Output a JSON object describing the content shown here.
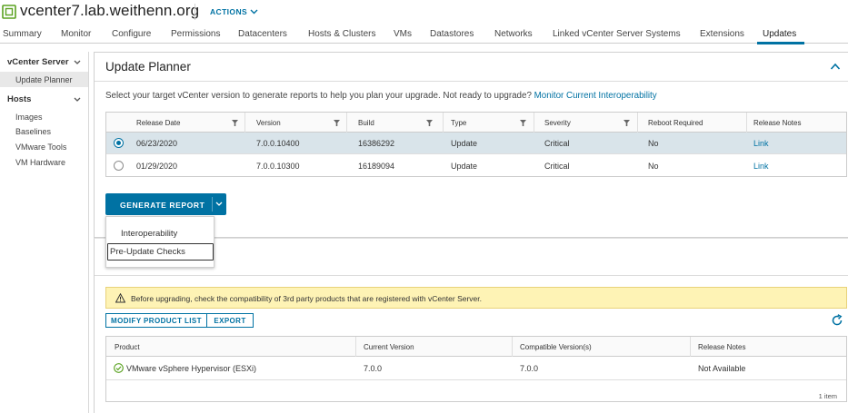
{
  "header": {
    "host": "vcenter7.lab.weithenn.org",
    "actions_label": "ACTIONS"
  },
  "tabs": [
    {
      "label": "Summary"
    },
    {
      "label": "Monitor"
    },
    {
      "label": "Configure"
    },
    {
      "label": "Permissions"
    },
    {
      "label": "Datacenters"
    },
    {
      "label": "Hosts & Clusters"
    },
    {
      "label": "VMs"
    },
    {
      "label": "Datastores"
    },
    {
      "label": "Networks"
    },
    {
      "label": "Linked vCenter Server Systems"
    },
    {
      "label": "Extensions"
    },
    {
      "label": "Updates",
      "active": true
    }
  ],
  "sidebar": {
    "groups": [
      {
        "label": "vCenter Server",
        "items": [
          {
            "label": "Update Planner",
            "active": true
          }
        ]
      },
      {
        "label": "Hosts",
        "items": [
          {
            "label": "Images"
          },
          {
            "label": "Baselines"
          },
          {
            "label": "VMware Tools"
          },
          {
            "label": "VM Hardware"
          }
        ]
      }
    ]
  },
  "planner": {
    "title": "Update Planner",
    "intro_text": "Select your target vCenter version to generate reports to help you plan your upgrade. Not ready to upgrade?",
    "intro_link": "Monitor Current Interoperability",
    "columns": [
      "Release Date",
      "Version",
      "Build",
      "Type",
      "Severity",
      "Reboot Required",
      "Release Notes"
    ],
    "rows": [
      {
        "release_date": "06/23/2020",
        "version": "7.0.0.10400",
        "build": "16386292",
        "type": "Update",
        "severity": "Critical",
        "reboot": "No",
        "notes": "Link",
        "selected": true
      },
      {
        "release_date": "01/29/2020",
        "version": "7.0.0.10300",
        "build": "16189094",
        "type": "Update",
        "severity": "Critical",
        "reboot": "No",
        "notes": "Link",
        "selected": false
      }
    ],
    "generate_label": "GENERATE REPORT",
    "menu": [
      "Interoperability",
      "Pre-Update Checks"
    ]
  },
  "interop": {
    "warning": "Before upgrading, check the compatibility of 3rd party products that are registered with vCenter Server.",
    "modify_label": "MODIFY PRODUCT LIST",
    "export_label": "EXPORT",
    "columns": [
      "Product",
      "Current Version",
      "Compatible Version(s)",
      "Release Notes"
    ],
    "rows": [
      {
        "product": "VMware vSphere Hypervisor (ESXi)",
        "current": "7.0.0",
        "compatible": "7.0.0",
        "notes": "Not Available"
      }
    ],
    "footer": "1 item"
  },
  "colors": {
    "accent": "#0072a3",
    "selected_row": "#d9e4ea",
    "warning_bg": "#fef3b5",
    "ok": "#5aa220"
  }
}
